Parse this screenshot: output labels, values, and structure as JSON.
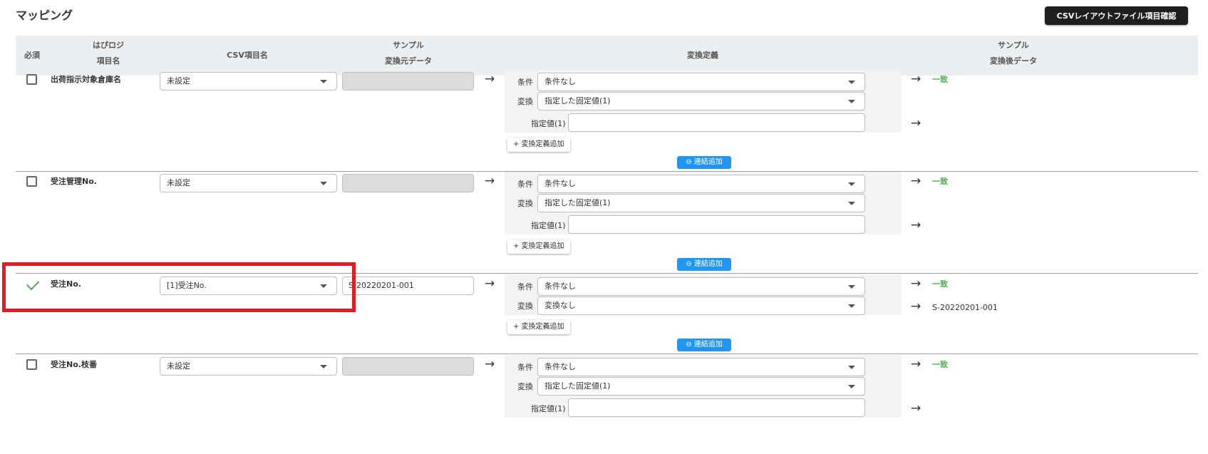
{
  "page": {
    "title": "マッピング",
    "layout_button_label": "CSVレイアウトファイル項目確認"
  },
  "table_header": {
    "required": "必須",
    "item_name_line1": "はぴロジ",
    "item_name_line2": "項目名",
    "csv_item": "CSV項目名",
    "sample_source_line1": "サンプル",
    "sample_source_line2": "変換元データ",
    "definition": "変換定義",
    "sample_result_line1": "サンプル",
    "sample_result_line2": "変換後データ"
  },
  "labels": {
    "condition": "条件",
    "conversion": "変換",
    "specified_value": "指定値(1)",
    "add_definition": "+ 変換定義追加",
    "link_add": "⊖ 連結追加",
    "match": "一致",
    "arrow": "→"
  },
  "rows": [
    {
      "name": "出荷指示対象倉庫名",
      "required_checked": false,
      "csv_item": "未設定",
      "sample_source": "",
      "condition": "条件なし",
      "conversion": "指定した固定値(1)",
      "specified_value": "",
      "result_value": ""
    },
    {
      "name": "受注管理No.",
      "required_checked": false,
      "csv_item": "未設定",
      "sample_source": "",
      "condition": "条件なし",
      "conversion": "指定した固定値(1)",
      "specified_value": "",
      "result_value": ""
    },
    {
      "name": "受注No.",
      "required_checked": true,
      "csv_item": "[1]受注No.",
      "sample_source": "S-20220201-001",
      "condition": "条件なし",
      "conversion": "変換なし",
      "result_value": "S-20220201-001"
    },
    {
      "name": "受注No.枝番",
      "required_checked": false,
      "csv_item": "未設定",
      "sample_source": "",
      "condition": "条件なし",
      "conversion": "指定した固定値(1)",
      "specified_value": "",
      "result_value": ""
    }
  ],
  "colors": {
    "highlight": "#e31b23",
    "link_button": "#2196f3",
    "match_text": "#4caf50",
    "header_bg": "#eceff1"
  }
}
